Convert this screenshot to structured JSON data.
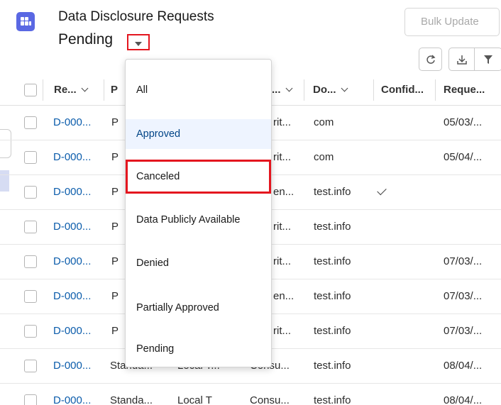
{
  "header": {
    "title": "Data Disclosure Requests",
    "view_name": "Pending",
    "bulk_update_label": "Bulk Update"
  },
  "toolbar": {
    "refresh_icon": "refresh-icon",
    "download_icon": "download-icon",
    "filter_icon": "filter-icon"
  },
  "columns": [
    "Re...",
    "P",
    "...",
    "Do...",
    "Confid...",
    "Reque..."
  ],
  "rows": [
    {
      "id": "D-000...",
      "c2": "P",
      "c3": "rit...",
      "c4": "com",
      "c5": "",
      "c6": "05/03/..."
    },
    {
      "id": "D-000...",
      "c2": "P",
      "c3": "rit...",
      "c4": "com",
      "c5": "",
      "c6": "05/04/..."
    },
    {
      "id": "D-000...",
      "c2": "P",
      "c3": "en...",
      "c4": "test.info",
      "c5": "✓",
      "c6": ""
    },
    {
      "id": "D-000...",
      "c2": "P",
      "c3": "rit...",
      "c4": "test.info",
      "c5": "",
      "c6": ""
    },
    {
      "id": "D-000...",
      "c2": "P",
      "c3": "rit...",
      "c4": "test.info",
      "c5": "",
      "c6": "07/03/..."
    },
    {
      "id": "D-000...",
      "c2": "P",
      "c3": "en...",
      "c4": "test.info",
      "c5": "",
      "c6": "07/03/..."
    },
    {
      "id": "D-000...",
      "c2": "P",
      "c3": "rit...",
      "c4": "test.info",
      "c5": "",
      "c6": "07/03/..."
    },
    {
      "id": "D-000...",
      "c2": "Standa...",
      "c3": "Consu...",
      "c4": "test.info",
      "c5": "",
      "c6": "08/04/..."
    },
    {
      "id": "D-000...",
      "c2": "Standa...",
      "c3": "Consu...",
      "c4": "test.info",
      "c5": "",
      "c6": "08/04/..."
    }
  ],
  "row_extra": {
    "local_t_a": "Local T...",
    "local_t_b": "Local T"
  },
  "dropdown": {
    "options": [
      "All",
      "Approved",
      "Canceled",
      "Data Publicly Available",
      "Denied",
      "Partially Approved",
      "Pending"
    ],
    "selected": "Approved",
    "highlighted": "Canceled"
  },
  "colors": {
    "accent": "#0b5cab",
    "app_icon": "#5a68e3",
    "highlight": "#e4161f"
  }
}
